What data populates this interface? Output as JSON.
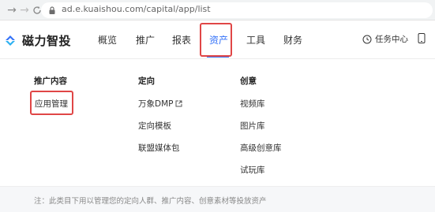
{
  "browser": {
    "url": "ad.e.kuaishou.com/capital/app/list"
  },
  "brand": {
    "name": "磁力智投",
    "accent_color": "#3472f8"
  },
  "nav": {
    "items": [
      {
        "label": "概览"
      },
      {
        "label": "推广"
      },
      {
        "label": "报表"
      },
      {
        "label": "资产",
        "active": true
      },
      {
        "label": "工具"
      },
      {
        "label": "财务"
      }
    ],
    "task_center": "任务中心"
  },
  "dropdown": {
    "columns": [
      {
        "title": "推广内容",
        "links": [
          "应用管理"
        ]
      },
      {
        "title": "定向",
        "links": [
          "万象DMP",
          "定向模板",
          "联盟媒体包"
        ]
      },
      {
        "title": "创意",
        "links": [
          "视频库",
          "图片库",
          "高级创意库",
          "试玩库"
        ]
      }
    ]
  },
  "note": "注：此类目下用以管理您的定向人群、推广内容、创意素材等投放资产",
  "highlight_color": "#e04646"
}
